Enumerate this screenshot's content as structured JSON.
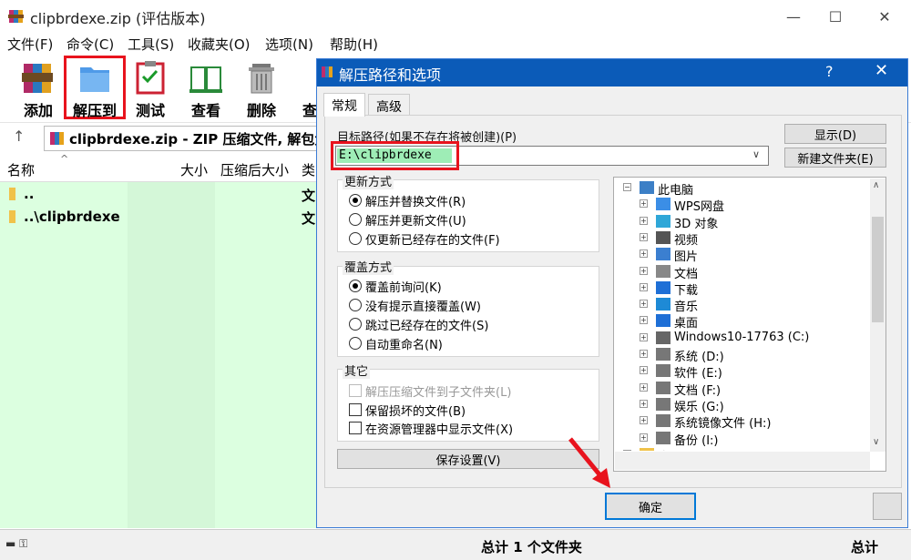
{
  "window": {
    "title": "clipbrdexe.zip (评估版本)",
    "minimize": "—",
    "maximize": "☐",
    "close": "✕"
  },
  "menu": [
    "文件(F)",
    "命令(C)",
    "工具(S)",
    "收藏夹(O)",
    "选项(N)",
    "帮助(H)"
  ],
  "toolbar": [
    "添加",
    "解压到",
    "测试",
    "查看",
    "删除",
    "查"
  ],
  "address": {
    "text": "clipbrdexe.zip - ZIP 压缩文件, 解包大"
  },
  "list": {
    "headers": [
      "名称",
      "大小",
      "压缩后大小",
      "类"
    ],
    "rows": [
      {
        "name": "..",
        "type": "文"
      },
      {
        "name": "..\\clipbrdexe",
        "type": "文"
      }
    ]
  },
  "status": {
    "summary": "总计 1 个文件夹",
    "right": "总计"
  },
  "dialog": {
    "title": "解压路径和选项",
    "help": "?",
    "close": "✕",
    "tabs": [
      "常规",
      "高级"
    ],
    "target_label": "目标路径(如果不存在将被创建)(P)",
    "target_value": "E:\\clipbrdexe",
    "show_button": "显示(D)",
    "new_folder_button": "新建文件夹(E)",
    "update_mode": {
      "title": "更新方式",
      "options": [
        "解压并替换文件(R)",
        "解压并更新文件(U)",
        "仅更新已经存在的文件(F)"
      ]
    },
    "overwrite_mode": {
      "title": "覆盖方式",
      "options": [
        "覆盖前询问(K)",
        "没有提示直接覆盖(W)",
        "跳过已经存在的文件(S)",
        "自动重命名(N)"
      ]
    },
    "misc": {
      "title": "其它",
      "options": [
        "解压压缩文件到子文件夹(L)",
        "保留损坏的文件(B)",
        "在资源管理器中显示文件(X)"
      ]
    },
    "save_button": "保存设置(V)",
    "ok_button": "确定",
    "tree": {
      "root": "此电脑",
      "items": [
        "WPS网盘",
        "3D 对象",
        "视频",
        "图片",
        "文档",
        "下载",
        "音乐",
        "桌面",
        "Windows10-17763 (C:)",
        "系统 (D:)",
        "软件 (E:)",
        "文档 (F:)",
        "娱乐 (G:)",
        "系统镜像文件 (H:)",
        "备份 (I:)"
      ],
      "partial": "库"
    }
  },
  "colors": {
    "accent": "#0b5bb8",
    "highlight": "#e8131d",
    "list_bg": "#dcffe0",
    "selection": "#9eedb6"
  }
}
